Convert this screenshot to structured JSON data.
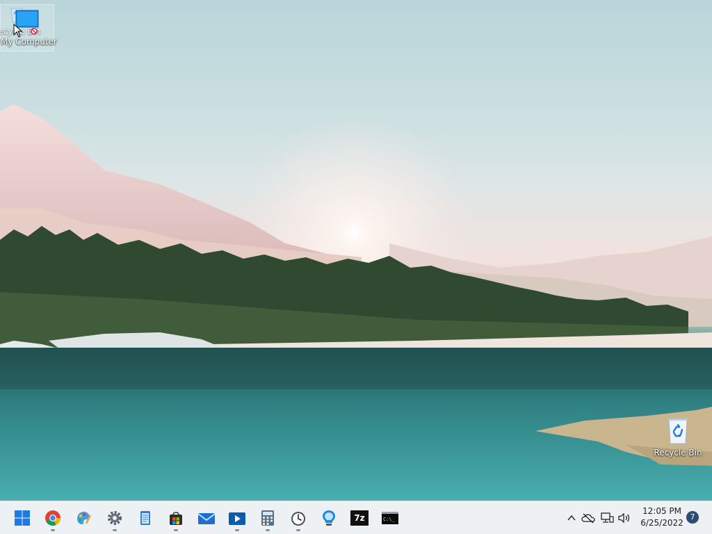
{
  "desktop": {
    "icons": {
      "my_computer": "My Computer",
      "recycle_ghost": "Recycle Bin",
      "recycle_bin": "Recycle Bin"
    }
  },
  "taskbar": {
    "apps": [
      {
        "name": "start",
        "icon": "windows-logo-icon"
      },
      {
        "name": "chrome",
        "icon": "chrome-icon"
      },
      {
        "name": "paint",
        "icon": "paint-icon"
      },
      {
        "name": "settings",
        "icon": "gear-icon"
      },
      {
        "name": "notepad",
        "icon": "notepad-icon"
      },
      {
        "name": "store",
        "icon": "store-icon"
      },
      {
        "name": "mail",
        "icon": "mail-icon"
      },
      {
        "name": "media-player",
        "icon": "media-player-icon"
      },
      {
        "name": "calculator",
        "icon": "calculator-icon"
      },
      {
        "name": "clock",
        "icon": "alarm-clock-icon"
      },
      {
        "name": "cortana",
        "icon": "lightbulb-icon"
      },
      {
        "name": "7zip",
        "icon": "7zip-icon",
        "text": "7z"
      },
      {
        "name": "terminal",
        "icon": "terminal-icon",
        "text": "C:\\_"
      }
    ],
    "tray": {
      "time": "12:05 PM",
      "date": "6/25/2022",
      "notifications": "7"
    }
  },
  "colors": {
    "accent": "#1f7ae0",
    "taskbar_bg": "#eef1f4",
    "badge": "#2b4c73"
  }
}
